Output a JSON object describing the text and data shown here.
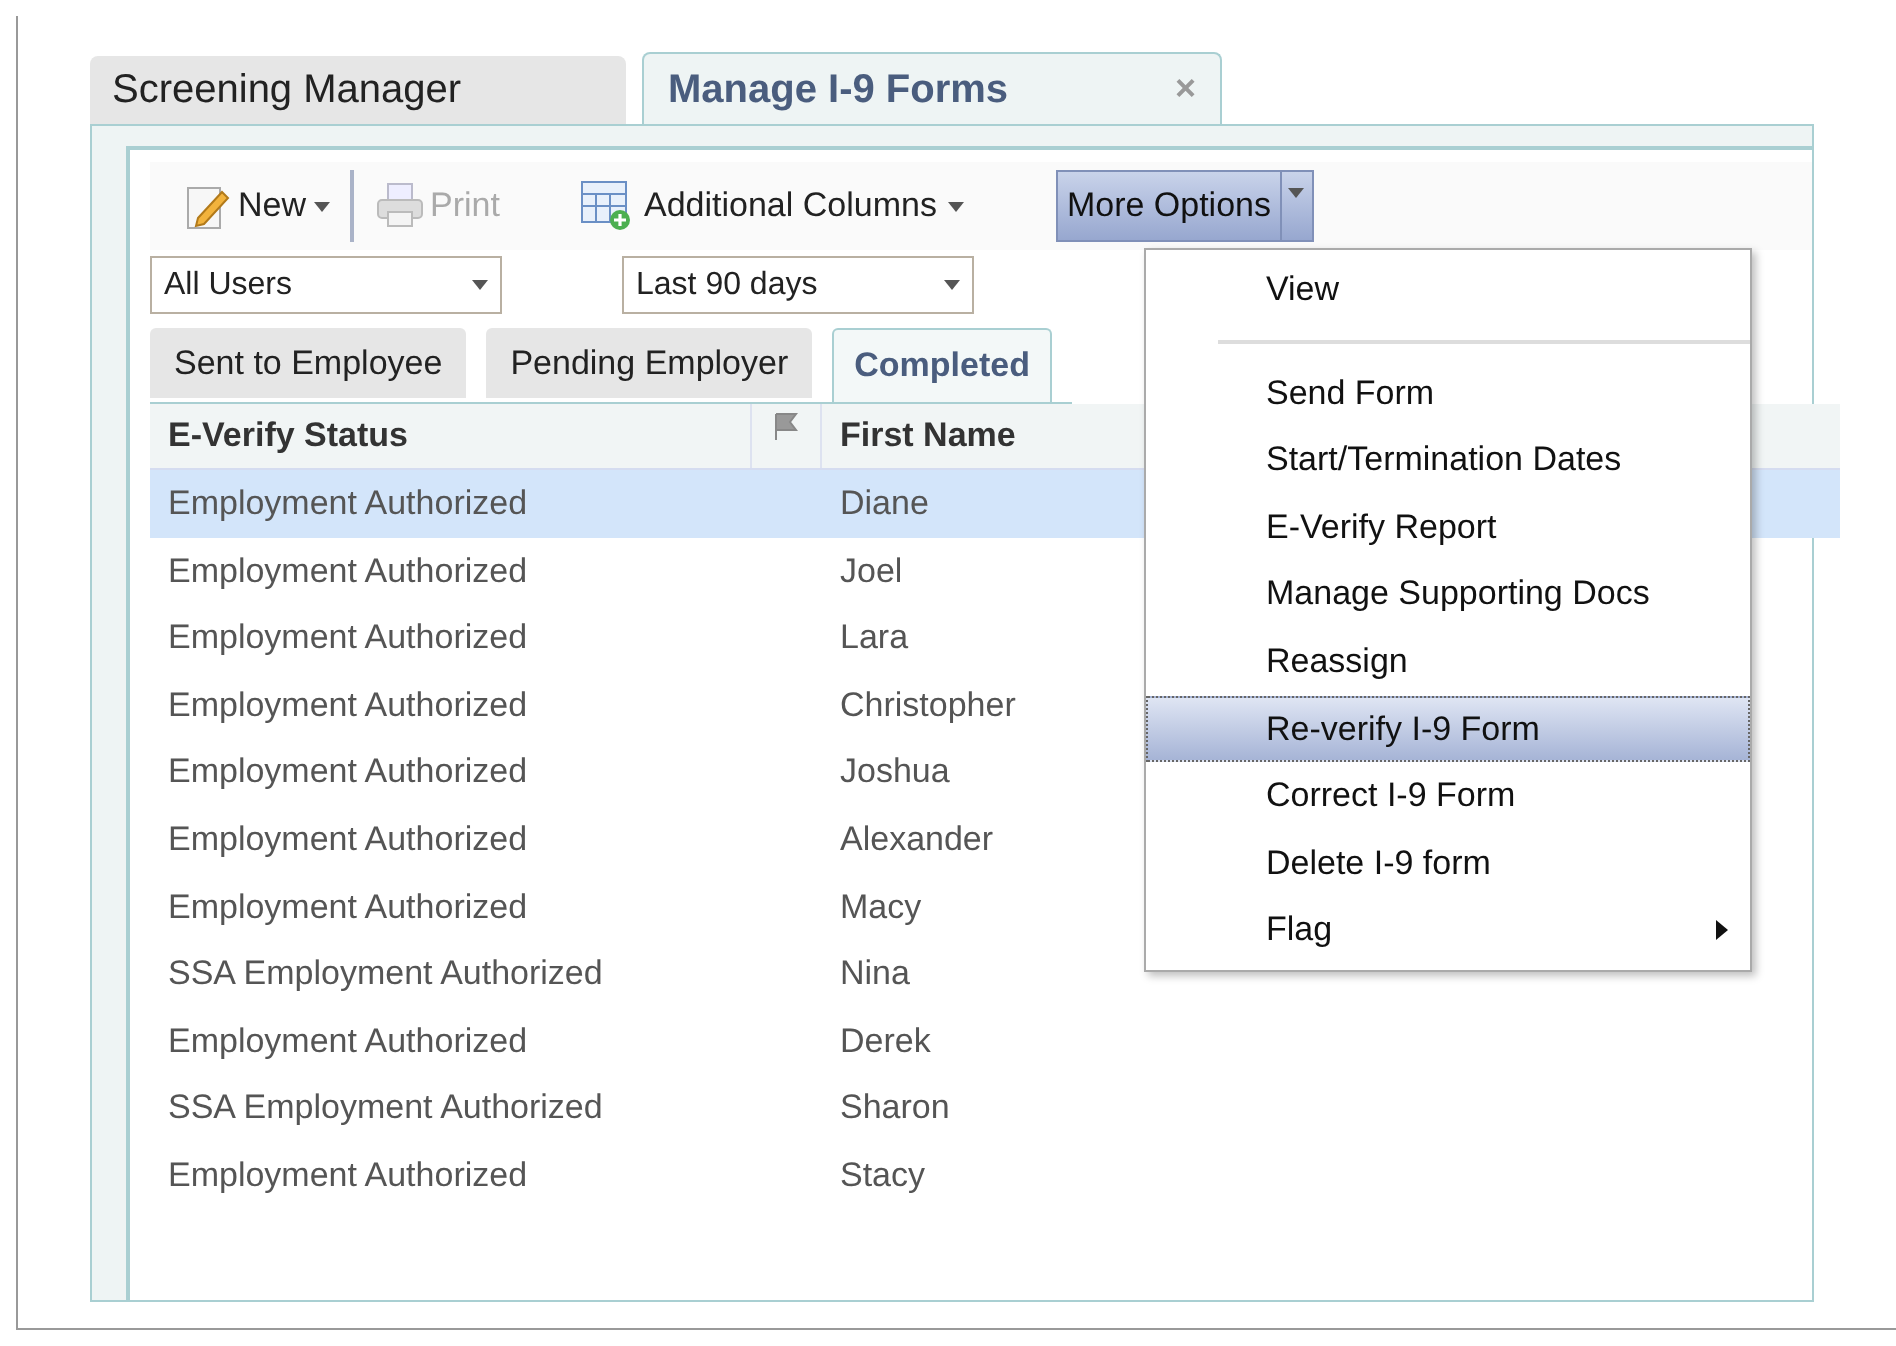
{
  "tabs": [
    {
      "label": "Screening Manager",
      "selected": false
    },
    {
      "label": "Manage I-9 Forms",
      "selected": true,
      "close": "×"
    }
  ],
  "toolbar": {
    "new": "New",
    "print": "Print",
    "additional_columns": "Additional Columns",
    "more_options": "More Options"
  },
  "filters": [
    {
      "value": "All Users"
    },
    {
      "value": "Last 90 days"
    }
  ],
  "subtabs": [
    {
      "label": "Sent to Employee",
      "selected": false
    },
    {
      "label": "Pending Employer",
      "selected": false
    },
    {
      "label": "Completed",
      "selected": true
    }
  ],
  "table": {
    "columns": [
      "E-Verify Status",
      "First Name"
    ],
    "rows": [
      {
        "status": "Employment Authorized",
        "first_name": "Diane",
        "selected": true
      },
      {
        "status": "Employment Authorized",
        "first_name": "Joel",
        "selected": false
      },
      {
        "status": "Employment Authorized",
        "first_name": "Lara",
        "selected": false
      },
      {
        "status": "Employment Authorized",
        "first_name": "Christopher",
        "selected": false
      },
      {
        "status": "Employment Authorized",
        "first_name": "Joshua",
        "selected": false
      },
      {
        "status": "Employment Authorized",
        "first_name": "Alexander",
        "selected": false
      },
      {
        "status": "Employment Authorized",
        "first_name": "Macy",
        "selected": false
      },
      {
        "status": "SSA Employment Authorized",
        "first_name": "Nina",
        "selected": false
      },
      {
        "status": "Employment Authorized",
        "first_name": "Derek",
        "selected": false
      },
      {
        "status": "SSA Employment Authorized",
        "first_name": "Sharon",
        "selected": false
      },
      {
        "status": "Employment Authorized",
        "first_name": "Stacy",
        "selected": false
      }
    ]
  },
  "menu": {
    "items": [
      {
        "label": "View",
        "selected": false,
        "separator_after": true,
        "submenu": false
      },
      {
        "label": "Send Form",
        "selected": false,
        "separator_after": false,
        "submenu": false
      },
      {
        "label": "Start/Termination Dates",
        "selected": false,
        "separator_after": false,
        "submenu": false
      },
      {
        "label": "E-Verify Report",
        "selected": false,
        "separator_after": false,
        "submenu": false
      },
      {
        "label": "Manage Supporting Docs",
        "selected": false,
        "separator_after": false,
        "submenu": false
      },
      {
        "label": "Reassign",
        "selected": false,
        "separator_after": false,
        "submenu": false
      },
      {
        "label": "Re-verify I-9 Form",
        "selected": true,
        "separator_after": false,
        "submenu": false
      },
      {
        "label": "Correct I-9 Form",
        "selected": false,
        "separator_after": false,
        "submenu": false
      },
      {
        "label": "Delete I-9 form",
        "selected": false,
        "separator_after": false,
        "submenu": false
      },
      {
        "label": "Flag",
        "selected": false,
        "separator_after": false,
        "submenu": true
      }
    ]
  }
}
